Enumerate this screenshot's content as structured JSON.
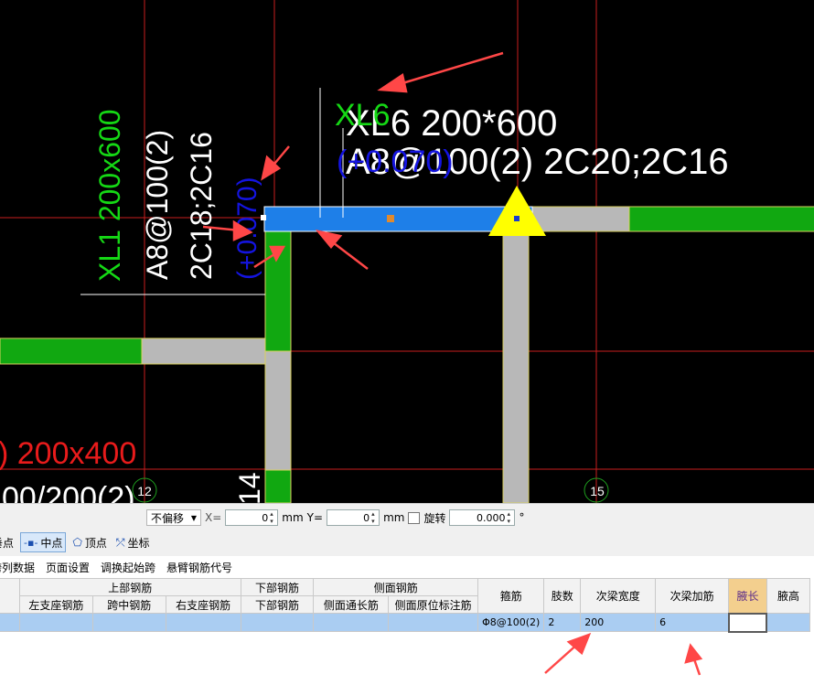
{
  "canvas": {
    "beam_labels": {
      "xl6_name": "XL6",
      "xl6_spec": "XL6 200*600",
      "xl6_rebar": "A8@100(2) 2C20;2C16",
      "xl6_elev": "(+0.070)",
      "xl1_name": "XL1 200x600",
      "xl1_stirrup": "A8@100(2)",
      "xl1_rebar": "2C18;2C16",
      "xl1_elev": "(+0.070)",
      "red_label": ") 200x400",
      "white_partial": "00/200(2)",
      "white_partial2": "14"
    },
    "axis_labels": [
      "12",
      "15"
    ],
    "colors": {
      "background": "#000000",
      "selected_beam": "#1e90ff",
      "green_beam": "#15b315",
      "gray_beam": "#b8b8b8",
      "axis_line": "#d01b1b",
      "arrow": "#ff4a4a",
      "marker": "#ffff00"
    }
  },
  "snap_toolbar": {
    "offset_mode": "不偏移",
    "x_label": "X=",
    "x_value": "0",
    "x_unit": "mm",
    "y_label": "Y=",
    "y_value": "0",
    "y_unit": "mm",
    "rotate_label": "旋转",
    "rotate_value": "0.000",
    "rotate_unit": "°",
    "snap_items": [
      "垂点",
      "中点",
      "顶点",
      "坐标"
    ]
  },
  "menu": {
    "items": [
      "跨列数据",
      "页面设置",
      "调换起始跨",
      "悬臂钢筋代号"
    ]
  },
  "table": {
    "group_headers": {
      "top": "上部钢筋",
      "bottom": "下部钢筋",
      "side": "侧面钢筋"
    },
    "columns": [
      "左支座钢筋",
      "跨中钢筋",
      "右支座钢筋",
      "下部钢筋",
      "侧面通长筋",
      "侧面原位标注筋",
      "箍筋",
      "肢数",
      "次梁宽度",
      "次梁加筋",
      "腋长",
      "腋高"
    ],
    "row": {
      "stirrup": "Φ8@100(2)",
      "legs": "2",
      "secondary_width": "200",
      "secondary_add": "6",
      "haunch_length": "",
      "haunch_height": ""
    }
  }
}
